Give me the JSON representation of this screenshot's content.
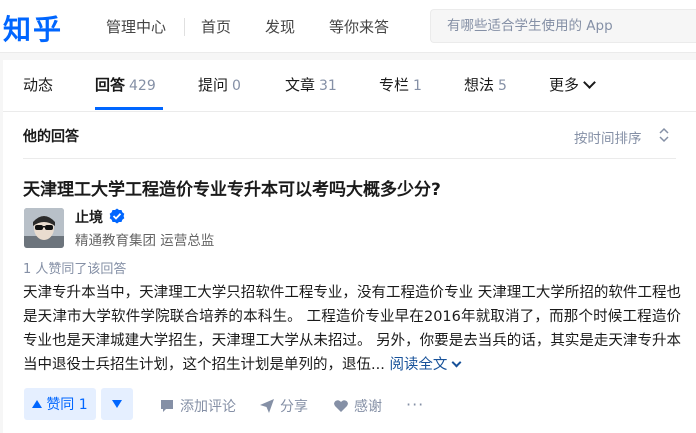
{
  "header": {
    "logo": "知乎",
    "nav": [
      "管理中心",
      "首页",
      "发现",
      "等你来答"
    ],
    "search_placeholder": "有哪些适合学生使用的 App"
  },
  "tabs": [
    {
      "label": "动态",
      "count": ""
    },
    {
      "label": "回答",
      "count": "429"
    },
    {
      "label": "提问",
      "count": "0"
    },
    {
      "label": "文章",
      "count": "31"
    },
    {
      "label": "专栏",
      "count": "1"
    },
    {
      "label": "想法",
      "count": "5"
    },
    {
      "label": "更多",
      "count": ""
    }
  ],
  "section": {
    "title": "他的回答",
    "sort_label": "按时间排序"
  },
  "answer": {
    "question_title": "天津理工大学工程造价专业专升本可以考吗大概多少分?",
    "author_name": "止境",
    "author_headline": "精通教育集团 运营总监",
    "votes_text": "1 人赞同了该回答",
    "excerpt": "天津专升本当中，天津理工大学只招软件工程专业，没有工程造价专业 天津理工大学所招的软件工程也是天津市大学软件学院联合培养的本科生。 工程造价专业早在2016年就取消了，而那个时候工程造价专业也是天津城建大学招生，天津理工大学从未招过。 另外，你要是去当兵的话，其实是走天津专升本当中退役士兵招生计划，这个招生计划是单列的，退伍...",
    "read_more": "阅读全文"
  },
  "actions": {
    "upvote": "赞同 1",
    "comment": "添加评论",
    "share": "分享",
    "thanks": "感谢",
    "more": "···"
  },
  "colors": {
    "brand": "#0066ff",
    "link": "#175199",
    "muted": "#8590a6",
    "vote_bg": "#e5efff"
  }
}
